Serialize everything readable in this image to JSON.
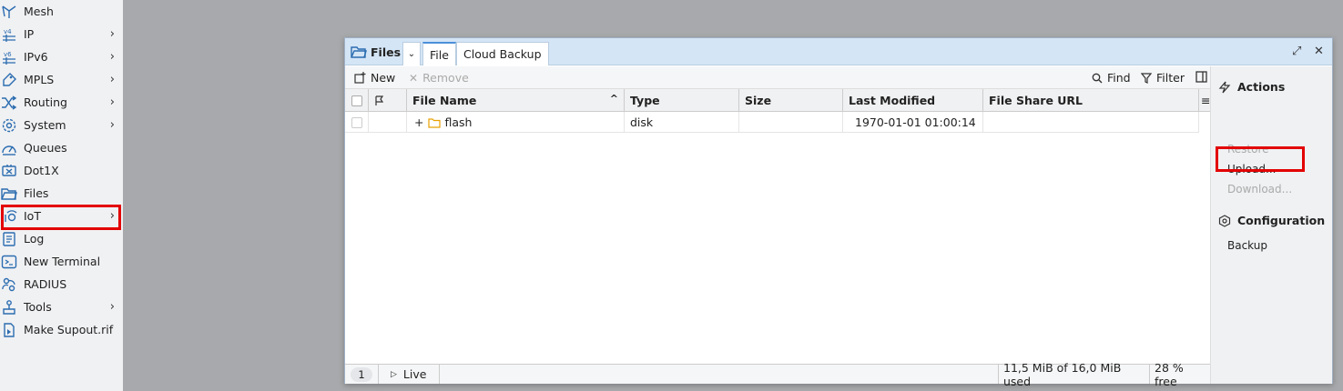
{
  "sidebar": {
    "items": [
      {
        "label": "Mesh",
        "icon": "mesh-icon",
        "arrow": false
      },
      {
        "label": "IP",
        "icon": "ipv4-icon",
        "arrow": true
      },
      {
        "label": "IPv6",
        "icon": "ipv6-icon",
        "arrow": true
      },
      {
        "label": "MPLS",
        "icon": "tag-icon",
        "arrow": true
      },
      {
        "label": "Routing",
        "icon": "shuffle-icon",
        "arrow": true
      },
      {
        "label": "System",
        "icon": "gear-icon",
        "arrow": true
      },
      {
        "label": "Queues",
        "icon": "gauge-icon",
        "arrow": false
      },
      {
        "label": "Dot1X",
        "icon": "dot1x-icon",
        "arrow": false
      },
      {
        "label": "Files",
        "icon": "folder-icon",
        "arrow": false
      },
      {
        "label": "IoT",
        "icon": "iot-icon",
        "arrow": true
      },
      {
        "label": "Log",
        "icon": "log-icon",
        "arrow": false
      },
      {
        "label": "New Terminal",
        "icon": "terminal-icon",
        "arrow": false
      },
      {
        "label": "RADIUS",
        "icon": "radius-icon",
        "arrow": false
      },
      {
        "label": "Tools",
        "icon": "tools-icon",
        "arrow": true
      },
      {
        "label": "Make Supout.rif",
        "icon": "document-icon",
        "arrow": false
      }
    ],
    "arrow_glyph": "›"
  },
  "window": {
    "title": "Files",
    "tabs": [
      "File",
      "Cloud Backup"
    ],
    "chevron": "⌄",
    "restore_glyph": "⤢",
    "close_glyph": "✕"
  },
  "toolbar": {
    "new_label": "New",
    "remove_label": "Remove",
    "find_label": "Find",
    "filter_label": "Filter"
  },
  "table": {
    "columns": [
      "File Name",
      "Type",
      "Size",
      "Last Modified",
      "File Share URL"
    ],
    "sort_glyph": "^",
    "menu_glyph": "≡",
    "rows": [
      {
        "expand": "+",
        "name": "flash",
        "type": "disk",
        "size": "",
        "modified": "1970-01-01 01:00:14",
        "url": ""
      }
    ]
  },
  "status": {
    "count": "1",
    "live_label": "Live",
    "used": "11,5 MiB of 16,0 MiB  used",
    "free": "28 % free"
  },
  "actions": {
    "heading": "Actions",
    "items": [
      {
        "label": "Restore",
        "enabled": false
      },
      {
        "label": "Upload...",
        "enabled": true
      },
      {
        "label": "Download...",
        "enabled": false
      }
    ]
  },
  "configuration": {
    "heading": "Configuration",
    "items": [
      "Backup"
    ]
  },
  "colors": {
    "highlight": "#e30000",
    "folder": "#e8a000",
    "icon_blue": "#2b6cb0"
  }
}
